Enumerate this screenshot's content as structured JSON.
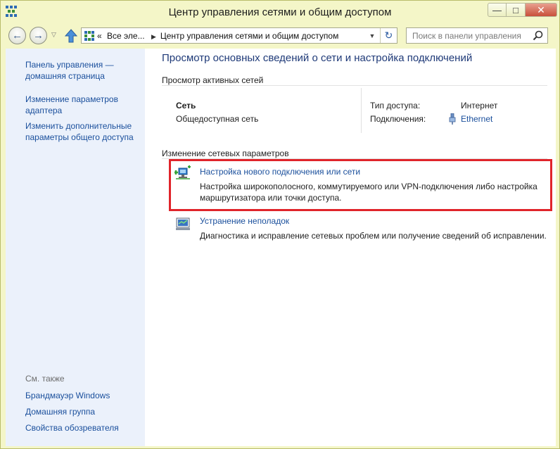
{
  "window": {
    "title": "Центр управления сетями и общим доступом",
    "min_glyph": "—",
    "max_glyph": "□",
    "close_glyph": "✕"
  },
  "nav": {
    "back_glyph": "←",
    "forward_glyph": "→",
    "recent_glyph": "▽",
    "breadcrumb_sep": "«",
    "breadcrumb": [
      "Все эле...",
      "Центр управления сетями и общим доступом"
    ],
    "dropdown_glyph": "▼",
    "refresh_glyph": "↻",
    "search_placeholder": "Поиск в панели управления"
  },
  "sidebar": {
    "links": [
      {
        "label_1": "Панель управления —",
        "label_2": "домашняя страница"
      },
      {
        "label_1": "Изменение параметров",
        "label_2": "адаптера"
      },
      {
        "label_1": "Изменить дополнительные",
        "label_2": "параметры общего доступа"
      }
    ],
    "see_also_heading": "См. также",
    "see_also": [
      "Брандмауэр Windows",
      "Домашняя группа",
      "Свойства обозревателя"
    ]
  },
  "main": {
    "title": "Просмотр основных сведений о сети и настройка подключений",
    "active_networks_label": "Просмотр активных сетей",
    "network": {
      "name": "Сеть",
      "type": "Общедоступная сеть",
      "access_type_key": "Тип доступа:",
      "access_type_value": "Интернет",
      "connections_key": "Подключения:",
      "connections_value": "Ethernet"
    },
    "change_settings_label": "Изменение сетевых параметров",
    "tasks": [
      {
        "link": "Настройка нового подключения или сети",
        "desc_1": "Настройка широкополосного, коммутируемого или VPN-подключения либо настройка",
        "desc_2": "маршрутизатора или точки доступа.",
        "icon": "network-setup-icon",
        "highlighted": true
      },
      {
        "link": "Устранение неполадок",
        "desc_1": "Диагностика и исправление сетевых проблем или получение сведений об исправлении.",
        "icon": "troubleshoot-icon",
        "highlighted": false
      }
    ]
  },
  "colors": {
    "frame": "#f4f6c8",
    "sidebar_bg": "#ebf1fb",
    "link": "#1a4f9c",
    "title": "#1f3a78",
    "highlight": "#e0242a"
  }
}
